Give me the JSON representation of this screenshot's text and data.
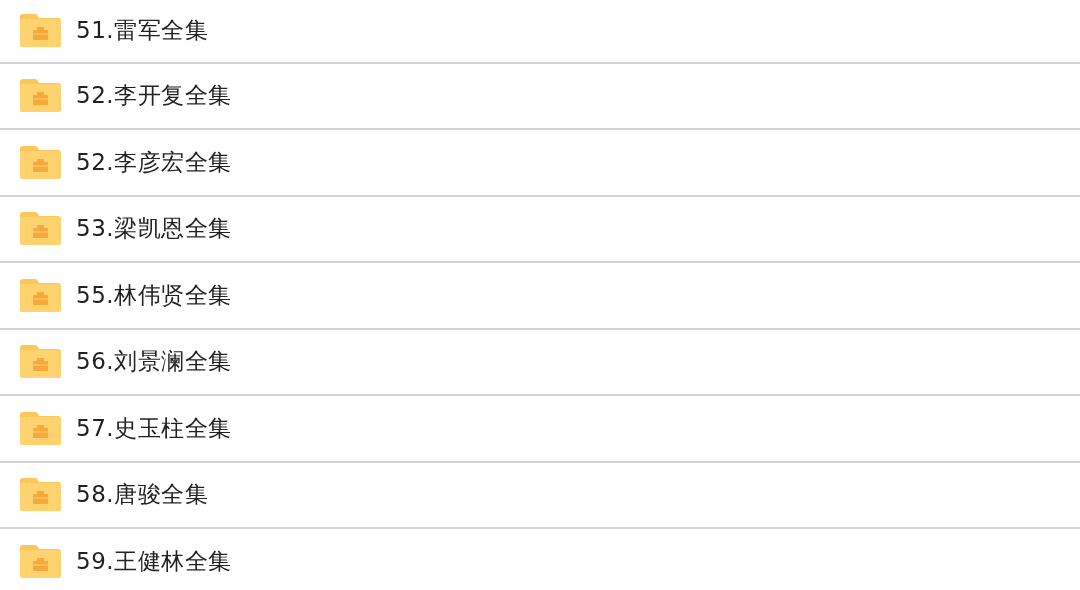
{
  "folders": [
    {
      "name": "51.雷军全集"
    },
    {
      "name": "52.李开复全集"
    },
    {
      "name": "52.李彦宏全集"
    },
    {
      "name": "53.梁凯恩全集"
    },
    {
      "name": "55.林伟贤全集"
    },
    {
      "name": "56.刘景澜全集"
    },
    {
      "name": "57.史玉柱全集"
    },
    {
      "name": "58.唐骏全集"
    },
    {
      "name": "59.王健林全集"
    }
  ]
}
